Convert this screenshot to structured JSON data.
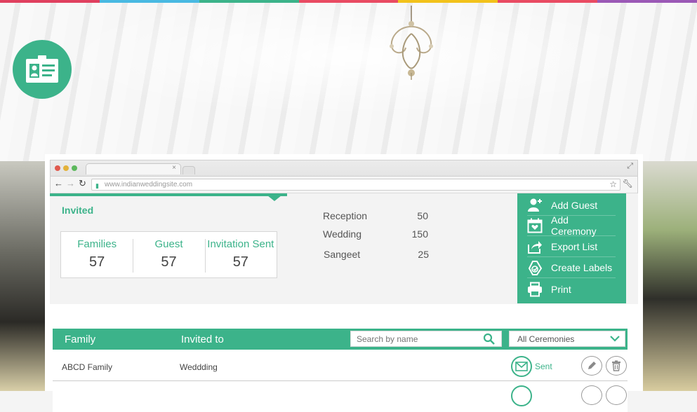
{
  "colors": {
    "accent": "#3cb38a",
    "stripes": [
      "#e0405f",
      "#49b9e2",
      "#3cb38a",
      "#e94b63",
      "#f2c21b",
      "#3cb38a",
      "#9b59b6"
    ]
  },
  "badge": {
    "icon": "id-card-icon"
  },
  "browser": {
    "url": "www.indianweddingsite.com",
    "tab_close": "×"
  },
  "invited": {
    "title": "Invited",
    "stats": [
      {
        "label": "Families",
        "value": "57"
      },
      {
        "label": "Guest",
        "value": "57"
      },
      {
        "label": "Invitation Sent",
        "value": "57"
      }
    ]
  },
  "ceremonies": [
    {
      "name": "Reception",
      "count": "50"
    },
    {
      "name": "Wedding",
      "count": "150"
    },
    {
      "name": "Sangeet",
      "count": "25"
    }
  ],
  "actions": [
    {
      "label": "Add Guest",
      "icon": "add-guest-icon"
    },
    {
      "label": "Add Ceremony",
      "icon": "calendar-heart-icon"
    },
    {
      "label": "Export List",
      "icon": "export-icon"
    },
    {
      "label": "Create Labels",
      "icon": "label-tag-icon"
    },
    {
      "label": "Print",
      "icon": "printer-icon"
    }
  ],
  "table": {
    "columns": {
      "family": "Family",
      "invited_to": "Invited to"
    },
    "search_placeholder": "Search by name",
    "filter_selected": "All Ceremonies",
    "rows": [
      {
        "family": "ABCD Family",
        "invited_to": "Weddding",
        "status": "Sent"
      },
      {
        "family": "",
        "invited_to": "",
        "status": ""
      }
    ]
  }
}
